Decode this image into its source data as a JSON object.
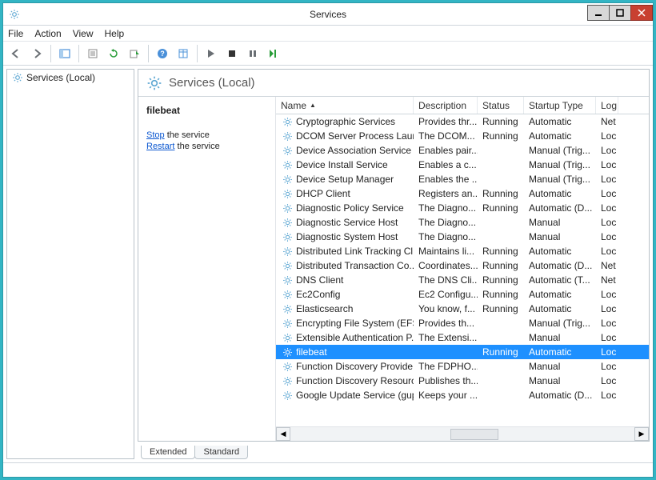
{
  "window": {
    "title": "Services"
  },
  "menubar": [
    "File",
    "Action",
    "View",
    "Help"
  ],
  "left_pane": {
    "root": "Services (Local)"
  },
  "pane_header": "Services (Local)",
  "detail": {
    "service_name": "filebeat",
    "stop_link": "Stop",
    "stop_rest": " the service",
    "restart_link": "Restart",
    "restart_rest": " the service"
  },
  "columns": {
    "name": "Name",
    "description": "Description",
    "status": "Status",
    "startup": "Startup Type",
    "logon": "Log"
  },
  "tabs": {
    "extended": "Extended",
    "standard": "Standard"
  },
  "services": [
    {
      "name": "Cryptographic Services",
      "desc": "Provides thr...",
      "status": "Running",
      "startup": "Automatic",
      "logon": "Net",
      "selected": false
    },
    {
      "name": "DCOM Server Process Laun...",
      "desc": "The DCOM...",
      "status": "Running",
      "startup": "Automatic",
      "logon": "Loc",
      "selected": false
    },
    {
      "name": "Device Association Service",
      "desc": "Enables pair...",
      "status": "",
      "startup": "Manual (Trig...",
      "logon": "Loc",
      "selected": false
    },
    {
      "name": "Device Install Service",
      "desc": "Enables a c...",
      "status": "",
      "startup": "Manual (Trig...",
      "logon": "Loc",
      "selected": false
    },
    {
      "name": "Device Setup Manager",
      "desc": "Enables the ...",
      "status": "",
      "startup": "Manual (Trig...",
      "logon": "Loc",
      "selected": false
    },
    {
      "name": "DHCP Client",
      "desc": "Registers an...",
      "status": "Running",
      "startup": "Automatic",
      "logon": "Loc",
      "selected": false
    },
    {
      "name": "Diagnostic Policy Service",
      "desc": "The Diagno...",
      "status": "Running",
      "startup": "Automatic (D...",
      "logon": "Loc",
      "selected": false
    },
    {
      "name": "Diagnostic Service Host",
      "desc": "The Diagno...",
      "status": "",
      "startup": "Manual",
      "logon": "Loc",
      "selected": false
    },
    {
      "name": "Diagnostic System Host",
      "desc": "The Diagno...",
      "status": "",
      "startup": "Manual",
      "logon": "Loc",
      "selected": false
    },
    {
      "name": "Distributed Link Tracking Cl...",
      "desc": "Maintains li...",
      "status": "Running",
      "startup": "Automatic",
      "logon": "Loc",
      "selected": false
    },
    {
      "name": "Distributed Transaction Co...",
      "desc": "Coordinates...",
      "status": "Running",
      "startup": "Automatic (D...",
      "logon": "Net",
      "selected": false
    },
    {
      "name": "DNS Client",
      "desc": "The DNS Cli...",
      "status": "Running",
      "startup": "Automatic (T...",
      "logon": "Net",
      "selected": false
    },
    {
      "name": "Ec2Config",
      "desc": "Ec2 Configu...",
      "status": "Running",
      "startup": "Automatic",
      "logon": "Loc",
      "selected": false
    },
    {
      "name": "Elasticsearch",
      "desc": "You know, f...",
      "status": "Running",
      "startup": "Automatic",
      "logon": "Loc",
      "selected": false
    },
    {
      "name": "Encrypting File System (EFS)",
      "desc": "Provides th...",
      "status": "",
      "startup": "Manual (Trig...",
      "logon": "Loc",
      "selected": false
    },
    {
      "name": "Extensible Authentication P...",
      "desc": "The Extensi...",
      "status": "",
      "startup": "Manual",
      "logon": "Loc",
      "selected": false
    },
    {
      "name": "filebeat",
      "desc": "",
      "status": "Running",
      "startup": "Automatic",
      "logon": "Loc",
      "selected": true
    },
    {
      "name": "Function Discovery Provide...",
      "desc": "The FDPHO...",
      "status": "",
      "startup": "Manual",
      "logon": "Loc",
      "selected": false
    },
    {
      "name": "Function Discovery Resourc...",
      "desc": "Publishes th...",
      "status": "",
      "startup": "Manual",
      "logon": "Loc",
      "selected": false
    },
    {
      "name": "Google Update Service (gup...",
      "desc": "Keeps your ...",
      "status": "",
      "startup": "Automatic (D...",
      "logon": "Loc",
      "selected": false
    }
  ]
}
